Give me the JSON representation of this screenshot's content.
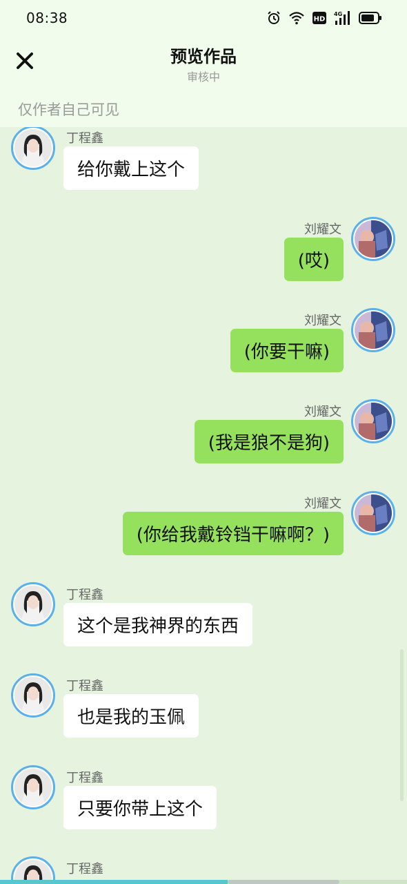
{
  "status_bar": {
    "time": "08:38",
    "icons": [
      "alarm-icon",
      "wifi-icon",
      "hd-icon",
      "signal-4g-icon",
      "battery-icon"
    ],
    "hd_label": "HD",
    "net_label": "4G"
  },
  "header": {
    "close_icon": "close-icon",
    "title": "预览作品",
    "subtitle": "审核中"
  },
  "visibility_note": "仅作者自己可见",
  "messages": [
    {
      "side": "left",
      "sender": "丁程鑫",
      "text": "给你戴上这个"
    },
    {
      "side": "right",
      "sender": "刘耀文",
      "text": "(哎)"
    },
    {
      "side": "right",
      "sender": "刘耀文",
      "text": "(你要干嘛)"
    },
    {
      "side": "right",
      "sender": "刘耀文",
      "text": "(我是狼不是狗)"
    },
    {
      "side": "right",
      "sender": "刘耀文",
      "text": "(你给我戴铃铛干嘛啊？)"
    },
    {
      "side": "left",
      "sender": "丁程鑫",
      "text": "这个是我神界的东西"
    },
    {
      "side": "left",
      "sender": "丁程鑫",
      "text": "也是我的玉佩"
    },
    {
      "side": "left",
      "sender": "丁程鑫",
      "text": "只要你带上这个"
    },
    {
      "side": "left",
      "sender": "丁程鑫",
      "text": ""
    }
  ],
  "colors": {
    "chat_background": "#e6f4df",
    "header_background": "#f1fced",
    "right_bubble": "#95e05c",
    "left_bubble": "#ffffff",
    "avatar_ring": "#5ab0ea"
  }
}
